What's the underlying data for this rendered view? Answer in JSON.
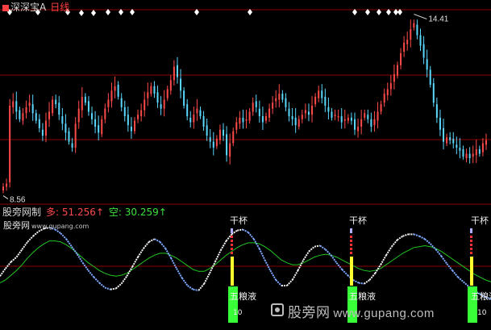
{
  "header": {
    "symbol": "深深宝A",
    "period": "日线"
  },
  "indicator": {
    "name": "股旁网制",
    "long_text": "多: 51.256↑",
    "short_text": "空: 30.259↑"
  },
  "watermark": {
    "small_label": "股旁网",
    "small_url": "www.gupang.com",
    "large_label": "股旁网",
    "large_url": "www.gupang.com"
  },
  "signals": {
    "top_labels": [
      "干杯",
      "干杯",
      "干杯"
    ],
    "bottom_labels": [
      "五粮液",
      "五粮液",
      "五粮液"
    ],
    "bottom_small": [
      "10",
      "10"
    ]
  },
  "colors": {
    "up": "#ff4a4a",
    "down": "#5ad8ff",
    "indicator_line": "#f0f0f0",
    "indicator_line_down": "#7fa8ff",
    "signal_line": "#22c722",
    "bar_green": "#39ff39",
    "bar_yellow": "#ffff30",
    "bar_red": "#ff3030",
    "grid": "#8b0000"
  },
  "chart_data": [
    {
      "type": "candlestick",
      "title": "深深宝A 日线",
      "ylim": [
        8.2,
        14.6
      ],
      "price_high_label": "14.41",
      "price_low_label": "8.56",
      "series": [
        {
          "name": "close",
          "values": [
            8.7,
            8.8,
            11.4,
            11.55,
            11.2,
            10.95,
            11.15,
            11.35,
            11.5,
            11.15,
            10.9,
            10.65,
            10.4,
            10.9,
            11.2,
            11.6,
            11.45,
            11.1,
            10.8,
            10.5,
            10.2,
            10.0,
            10.8,
            11.3,
            11.7,
            11.5,
            11.2,
            10.95,
            10.7,
            10.5,
            10.95,
            11.3,
            11.6,
            11.9,
            12.05,
            11.7,
            11.35,
            11.05,
            10.75,
            10.55,
            10.9,
            11.1,
            11.25,
            11.6,
            11.85,
            12.05,
            11.8,
            11.5,
            11.3,
            11.6,
            11.95,
            12.25,
            12.7,
            12.35,
            11.9,
            11.4,
            11.05,
            10.85,
            11.1,
            11.3,
            11.05,
            10.7,
            10.4,
            10.2,
            10.0,
            10.3,
            10.6,
            10.4,
            9.75,
            10.15,
            10.55,
            10.85,
            11.0,
            10.85,
            10.95,
            11.2,
            11.5,
            11.35,
            11.05,
            10.85,
            11.05,
            11.3,
            11.5,
            11.65,
            11.8,
            11.6,
            11.35,
            11.05,
            10.95,
            10.75,
            10.95,
            11.1,
            11.25,
            11.1,
            11.4,
            11.7,
            11.9,
            11.65,
            11.4,
            11.2,
            11.0,
            11.1,
            11.05,
            10.85,
            10.95,
            11.0,
            10.9,
            10.6,
            10.7,
            10.95,
            11.15,
            10.95,
            10.7,
            10.95,
            11.2,
            11.45,
            11.8,
            11.95,
            12.15,
            12.45,
            12.75,
            13.15,
            13.5,
            13.6,
            13.95,
            14.15,
            13.75,
            13.4,
            13.0,
            12.6,
            12.1,
            11.5,
            11.0,
            10.6,
            10.2,
            10.35,
            10.25,
            10.15,
            10.0,
            9.9,
            9.7,
            9.8,
            9.65,
            9.8,
            9.95,
            9.8,
            10.15,
            10.25
          ]
        }
      ]
    },
    {
      "type": "line",
      "title": "股旁网制",
      "ylim": [
        0,
        100
      ],
      "series": [
        {
          "name": "多",
          "values": [
            32,
            40,
            47,
            52,
            60,
            68,
            74,
            79,
            82,
            83,
            81,
            77,
            71,
            63,
            55,
            46,
            38,
            31,
            25,
            20,
            18,
            19,
            24,
            32,
            42,
            52,
            61,
            68,
            71,
            68,
            61,
            51,
            40,
            30,
            22,
            18,
            17,
            24,
            35,
            47,
            59,
            69,
            76,
            80,
            81,
            78,
            71,
            61,
            49,
            38,
            28,
            22,
            22,
            28,
            38,
            49,
            58,
            63,
            64,
            60,
            54,
            46,
            39,
            33,
            28,
            25,
            24,
            28,
            35,
            44,
            54,
            63,
            70,
            74,
            76,
            76,
            74,
            71,
            66,
            60,
            53,
            45,
            38,
            31,
            26,
            21,
            17,
            13,
            10,
            8
          ]
        },
        {
          "name": "空",
          "values": [
            25,
            28,
            33,
            38,
            44,
            51,
            57,
            62,
            66,
            69,
            69,
            68,
            65,
            61,
            56,
            51,
            46,
            42,
            38,
            35,
            33,
            32,
            33,
            35,
            39,
            43,
            47,
            51,
            54,
            56,
            56,
            54,
            51,
            47,
            43,
            39,
            37,
            37,
            40,
            44,
            49,
            54,
            58,
            62,
            65,
            67,
            67,
            66,
            63,
            59,
            54,
            49,
            46,
            44,
            44,
            46,
            49,
            52,
            54,
            55,
            54,
            52,
            49,
            46,
            43,
            40,
            38,
            37,
            38,
            40,
            44,
            48,
            52,
            56,
            59,
            62,
            63,
            64,
            63,
            61,
            58,
            54,
            50,
            46,
            42,
            38,
            34,
            31,
            28,
            26
          ]
        }
      ]
    }
  ]
}
